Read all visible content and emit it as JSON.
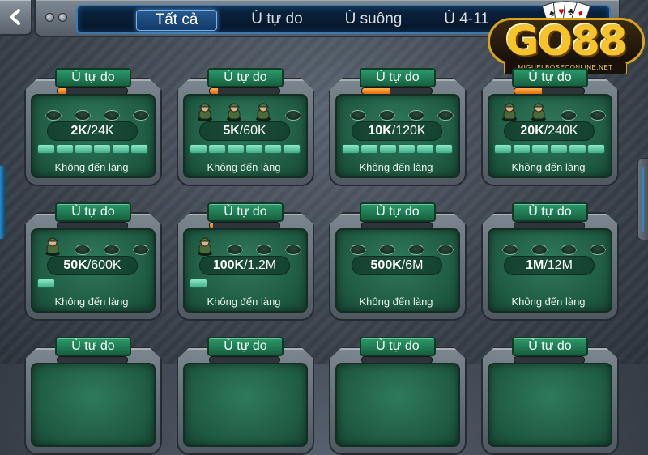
{
  "tabs": [
    "Tất cả",
    "Ù tự do",
    "Ù suông",
    "Ù 4-11"
  ],
  "active_tab": "Tất cả",
  "logo": {
    "text": "GO88",
    "url": "MIGUELBOSECONLINE.NET",
    "cards": [
      "♠",
      "♥",
      "♣",
      "♦"
    ]
  },
  "rooms": [
    {
      "title": "Ù tự do",
      "min": "2K",
      "max": "/24K",
      "label": "Không đến làng",
      "progress": 0.12,
      "players": 0,
      "chips": 6
    },
    {
      "title": "Ù tự do",
      "min": "5K",
      "max": "/60K",
      "label": "Không đến làng",
      "progress": 0.12,
      "players": 3,
      "chips": 6
    },
    {
      "title": "Ù tự do",
      "min": "10K",
      "max": "/120K",
      "label": "Không đến làng",
      "progress": 0.4,
      "players": 0,
      "chips": 6
    },
    {
      "title": "Ù tự do",
      "min": "20K",
      "max": "/240K",
      "label": "Không đến làng",
      "progress": 0.4,
      "players": 2,
      "chips": 6
    },
    {
      "title": "Ù tự do",
      "min": "50K",
      "max": "/600K",
      "label": "Không đến làng",
      "progress": 0.0,
      "players": 1,
      "chips": 1
    },
    {
      "title": "Ù tự do",
      "min": "100K",
      "max": "/1.2M",
      "label": "Không đến làng",
      "progress": 0.05,
      "players": 1,
      "chips": 1
    },
    {
      "title": "Ù tự do",
      "min": "500K",
      "max": "/6M",
      "label": "Không đến làng",
      "progress": 0.0,
      "players": 0,
      "chips": 0
    },
    {
      "title": "Ù tự do",
      "min": "1M",
      "max": "/12M",
      "label": "Không đến làng",
      "progress": 0.0,
      "players": 0,
      "chips": 0
    },
    {
      "title": "Ù tự do"
    },
    {
      "title": "Ù tự do"
    },
    {
      "title": "Ù tự do"
    },
    {
      "title": "Ù tự do"
    }
  ],
  "colors": {
    "accent": "#2a88c8",
    "table_green": "#1f5a42",
    "title_green": "#2a9a6a",
    "progress": "#e06d10",
    "logo_gold": "#f6c42a"
  }
}
